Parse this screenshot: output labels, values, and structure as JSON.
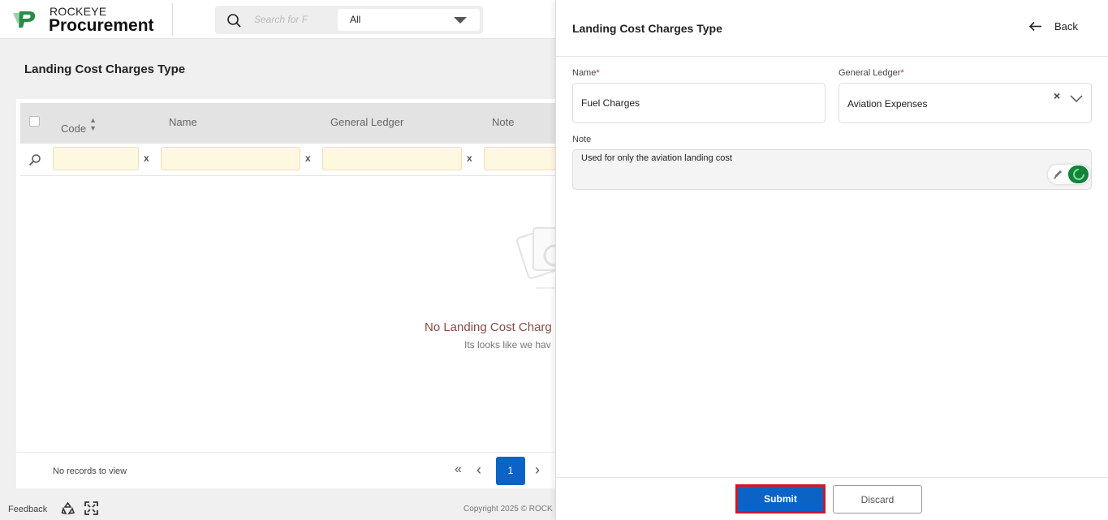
{
  "app": {
    "brand_small": "ROCKEYE",
    "brand_big": "Procurement"
  },
  "search": {
    "placeholder": "Search for F",
    "scope_selected": "All"
  },
  "page": {
    "title": "Landing Cost Charges Type"
  },
  "grid": {
    "columns": [
      "Code",
      "Name",
      "General Ledger",
      "Note"
    ],
    "filter_clear_label": "x",
    "empty_title": "No Landing Cost Charg",
    "empty_subtitle": "Its looks like we hav",
    "records_text": "No records to view",
    "pagination": {
      "first": "«",
      "prev": "‹",
      "current_page": "1",
      "next": "›"
    }
  },
  "footer": {
    "feedback": "Feedback",
    "copyright": "Copyright 2025 © ROCK"
  },
  "drawer": {
    "title": "Landing Cost Charges Type",
    "back_label": "Back",
    "fields": {
      "name_label": "Name",
      "name_value": "Fuel Charges",
      "gl_label": "General Ledger",
      "gl_value": "Aviation Expenses",
      "gl_clear": "×",
      "required_mark": "*",
      "note_label": "Note",
      "note_value": "Used for only the aviation landing cost"
    },
    "submit_label": "Submit",
    "discard_label": "Discard"
  },
  "colors": {
    "primary": "#0b63c5",
    "submit_highlight_border": "#d0162b",
    "empty_title": "#8a4a42",
    "filter_bg": "#fff8e0",
    "tool_green": "#12833a"
  },
  "icons": [
    "logo-icon",
    "search-icon",
    "chevron-down-icon",
    "sort-icon",
    "filter-search-icon",
    "empty-state-icon",
    "recycle-icon",
    "fullscreen-icon",
    "back-arrow-icon",
    "clear-icon",
    "pen-icon",
    "spinner-icon"
  ]
}
